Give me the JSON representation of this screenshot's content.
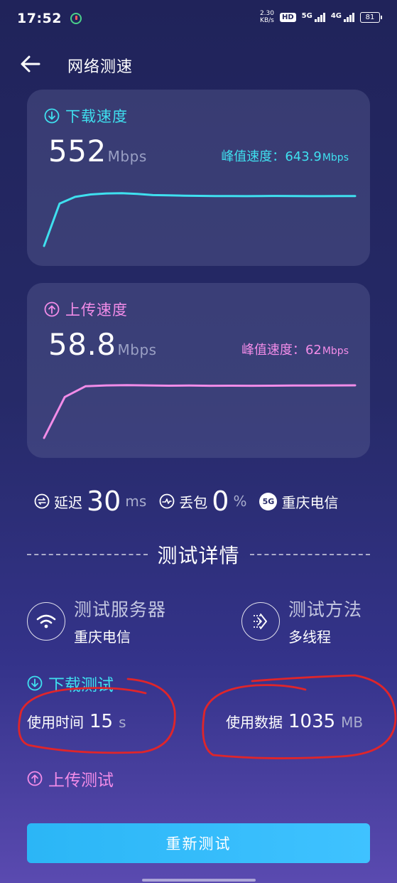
{
  "status_bar": {
    "time": "17:52",
    "net_speed_value": "2.30",
    "net_speed_unit": "KB/s",
    "hd_label": "HD",
    "sim1_label": "5G",
    "sim2_label": "4G",
    "battery": "81"
  },
  "header": {
    "title": "网络测速"
  },
  "download_card": {
    "title": "下载速度",
    "value": "552",
    "unit": "Mbps",
    "peak_label": "峰值速度：",
    "peak_value": "643.9",
    "peak_unit": "Mbps",
    "color": "#3fe0ef",
    "trend": [
      0,
      440,
      510,
      535,
      545,
      548,
      540,
      528,
      525,
      522,
      520,
      518,
      518,
      517,
      518,
      519,
      518,
      517,
      517,
      518,
      518
    ]
  },
  "upload_card": {
    "title": "上传速度",
    "value": "58.8",
    "unit": "Mbps",
    "peak_label": "峰值速度：",
    "peak_value": "62",
    "peak_unit": "Mbps",
    "color": "#f28ce8",
    "trend": [
      0,
      46,
      58,
      59,
      59.3,
      59,
      58.7,
      58.8,
      58.6,
      58.7,
      58.6,
      58.7,
      58.8,
      58.9,
      59,
      59.1
    ]
  },
  "metrics": {
    "latency_label": "延迟",
    "latency_value": "30",
    "latency_unit": "ms",
    "loss_label": "丢包",
    "loss_value": "0",
    "loss_unit": "%",
    "network_badge": "5G",
    "carrier": "重庆电信"
  },
  "details": {
    "section_title": "测试详情",
    "server_label": "测试服务器",
    "server_value": "重庆电信",
    "method_label": "测试方法",
    "method_value": "多线程"
  },
  "download_test": {
    "title": "下载测试",
    "time_label": "使用时间",
    "time_value": "15",
    "time_unit": "s",
    "data_label": "使用数据",
    "data_value": "1035",
    "data_unit": "MB"
  },
  "upload_test": {
    "title": "上传测试"
  },
  "actions": {
    "retest_label": "重新测试"
  },
  "colors": {
    "accent_cyan": "#3fe0ef",
    "accent_pink": "#f28ce8",
    "button": "#2bb6f6",
    "annotation_red": "#e0252a"
  }
}
